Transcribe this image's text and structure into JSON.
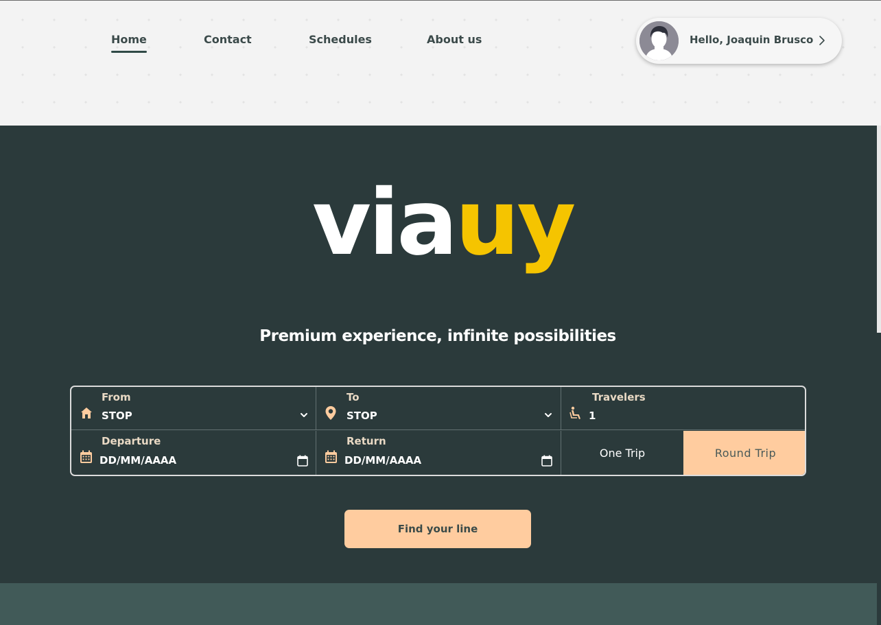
{
  "nav": {
    "items": [
      {
        "label": "Home",
        "active": true
      },
      {
        "label": "Contact",
        "active": false
      },
      {
        "label": "Schedules",
        "active": false
      },
      {
        "label": "About us",
        "active": false
      }
    ]
  },
  "user": {
    "greeting": "Hello, Joaquin Brusco",
    "avatar_icon": "user-avatar-icon",
    "chevron_icon": "chevron-right-icon"
  },
  "hero": {
    "logo": {
      "part1": "via",
      "part2": "uy"
    },
    "tagline": "Premium experience, infinite possibilities"
  },
  "search": {
    "from": {
      "label": "From",
      "value": "STOP",
      "icon": "home-icon"
    },
    "to": {
      "label": "To",
      "value": "STOP",
      "icon": "map-pin-icon"
    },
    "travelers": {
      "label": "Travelers",
      "value": "1",
      "icon": "seat-icon"
    },
    "departure": {
      "label": "Departure",
      "placeholder": "DD/MM/AAAA",
      "icon": "calendar-icon"
    },
    "return": {
      "label": "Return",
      "placeholder": "DD/MM/AAAA",
      "icon": "calendar-icon"
    },
    "trip_type": {
      "one_trip": "One Trip",
      "round_trip": "Round Trip",
      "selected": "Round Trip"
    },
    "find_button": "Find your line"
  },
  "colors": {
    "accent": "#ffcc9f",
    "logo_yellow": "#f5c400",
    "hero_bg": "#2b3a3b",
    "label_peach": "#e9d9c4"
  }
}
